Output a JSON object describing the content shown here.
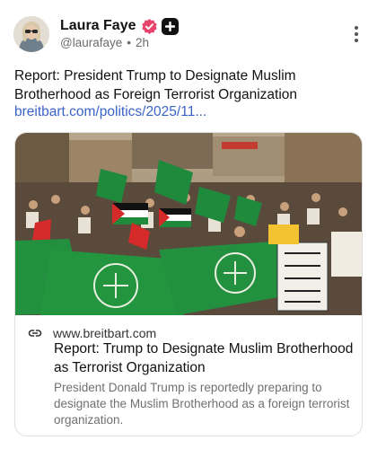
{
  "author": {
    "display_name": "Laura Faye",
    "handle": "@laurafaye",
    "time_ago": "2h",
    "separator": "•",
    "avatar_icon": "avatar",
    "badges": [
      "verified-badge-icon",
      "plus-badge-icon"
    ]
  },
  "post": {
    "text": "Report: President Trump to Designate Muslim Brotherhood as Foreign Terrorist Organization",
    "link_text": "breitbart.com/politics/2025/11..."
  },
  "link_card": {
    "image_icon": "news-photo",
    "domain": "www.breitbart.com",
    "title": "Report: Trump to Designate Muslim Brotherhood as Terrorist Organization",
    "description": "President Donald Trump is reportedly preparing to designate the Muslim Brotherhood as a foreign terrorist organization."
  },
  "colors": {
    "verified_badge": "#e8436b",
    "link": "#3a63c9",
    "flag_green": "#1f8a3b"
  }
}
